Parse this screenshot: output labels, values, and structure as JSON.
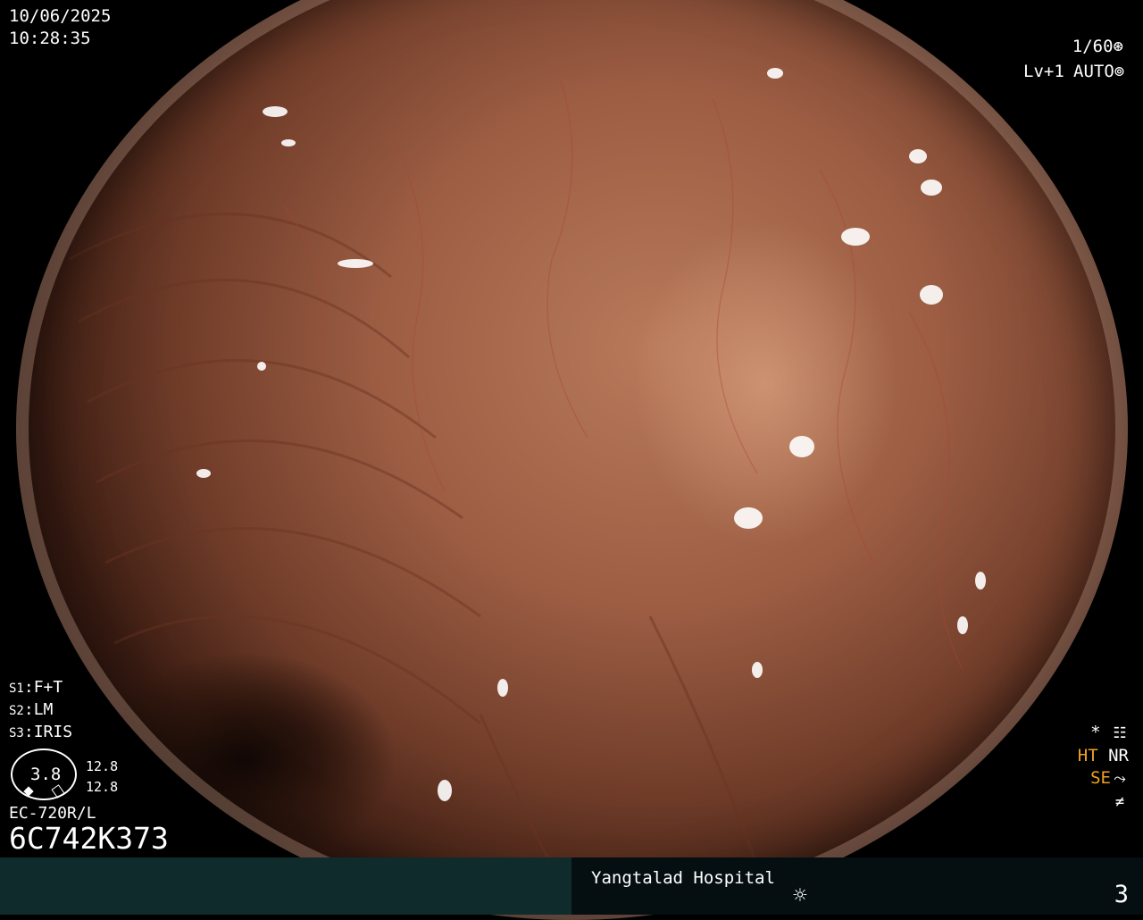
{
  "overlay": {
    "date": "10/06/2025",
    "time": "10:28:35",
    "shutter": "1/60",
    "shutter_icon": "aperture-icon",
    "level": "Lv+1",
    "exposure_mode": "AUTO",
    "exposure_icon": "iris-icon",
    "settings": [
      {
        "key": "S1",
        "value": "F+T"
      },
      {
        "key": "S2",
        "value": "LM"
      },
      {
        "key": "S3",
        "value": "IRIS"
      }
    ],
    "gauge_value": "3.8",
    "gauge_side_values": [
      "12.8",
      "12.8"
    ],
    "scope_model": "EC-720R/L",
    "scope_serial": "6C742K373",
    "mode_icons": {
      "star": "*",
      "ht": "HT",
      "nr": "NR",
      "se": "SE"
    },
    "colors": {
      "accent_orange": "#f0a020",
      "bottom_bar_left": "#0f2b2b",
      "bottom_bar_right": "#050f12"
    }
  },
  "footer": {
    "hospital": "Yangtalad Hospital",
    "light_icon": "sun-icon",
    "image_number": "3"
  }
}
